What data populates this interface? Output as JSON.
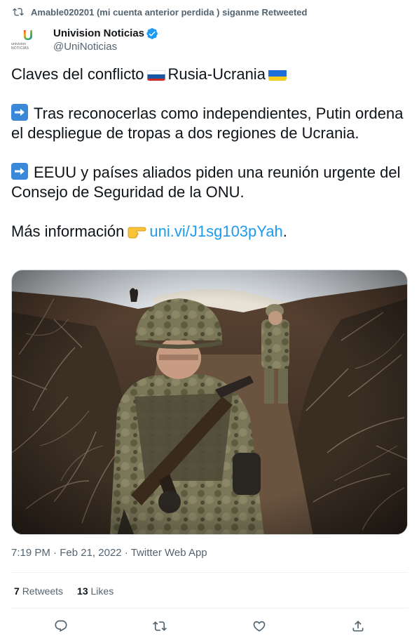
{
  "retweet_context": {
    "text": "Amable020201 (mi cuenta anterior perdida ) siganme Retweeted",
    "icon": "retweet-icon"
  },
  "author": {
    "name": "Univision Noticias",
    "handle": "@UniNoticias",
    "verified": true,
    "avatar_logo": "U",
    "avatar_sub": "univision NOTICIAS"
  },
  "tweet": {
    "line1_a": "Claves del conflicto",
    "line1_b": "Rusia-Ucrania",
    "para2": "Tras reconocerlas como independientes, Putin ordena el despliegue de tropas a dos regiones de Ucrania.",
    "para3": "EEUU y países aliados piden una reunión urgente del Consejo de Seguridad de la ONU.",
    "para4_text": "Más información",
    "para4_link": "uni.vi/J1sg103pYah",
    "para4_end": "."
  },
  "media": {
    "alt": "Soldier walking in a trench"
  },
  "meta": {
    "time": "7:19 PM",
    "date": "Feb 21, 2022",
    "source": "Twitter Web App",
    "sep": "·"
  },
  "stats": {
    "retweets_count": "7",
    "retweets_label": "Retweets",
    "likes_count": "13",
    "likes_label": "Likes"
  },
  "actions": [
    "reply",
    "retweet",
    "like",
    "share"
  ],
  "colors": {
    "link": "#1d9bf0",
    "secondary": "#536471",
    "verified": "#1d9bf0",
    "divider": "#eff3f4"
  }
}
